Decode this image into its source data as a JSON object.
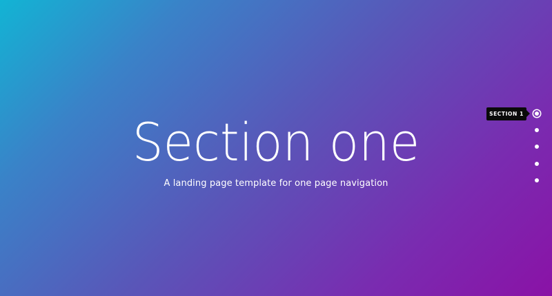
{
  "hero": {
    "title": "Section one",
    "subtitle": "A landing page template for one page navigation"
  },
  "dot_nav": {
    "active_index": 0,
    "tooltip_label": "SECTION 1",
    "item_count": 5
  },
  "colors": {
    "gradient_start": "#12b4d4",
    "gradient_end": "#8a12a6",
    "tooltip_bg": "#0a0a0a",
    "text": "#ffffff"
  }
}
